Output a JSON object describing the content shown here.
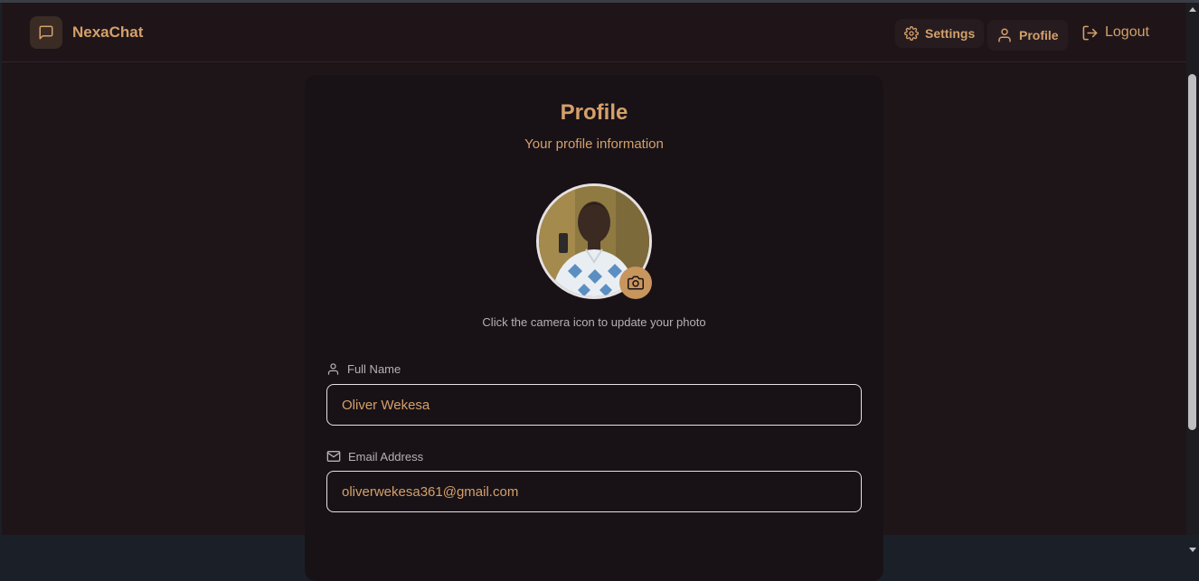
{
  "app": {
    "name": "NexaChat"
  },
  "nav": {
    "settings_label": "Settings",
    "profile_label": "Profile",
    "logout_label": "Logout"
  },
  "profile": {
    "title": "Profile",
    "subtitle": "Your profile information",
    "photo_hint": "Click the camera icon to update your photo",
    "full_name_label": "Full Name",
    "full_name_value": "Oliver Wekesa",
    "email_label": "Email Address",
    "email_value": "oliverwekesa361@gmail.com"
  },
  "icons": {
    "brand": "message-square-icon",
    "settings": "gear-icon",
    "profile": "user-icon",
    "logout": "logout-icon",
    "camera": "camera-icon",
    "name": "user-icon",
    "email": "mail-icon"
  },
  "colors": {
    "accent": "#d4a06a",
    "background": "#1e1519",
    "card": "#181217",
    "camera_button": "#c8955d"
  }
}
